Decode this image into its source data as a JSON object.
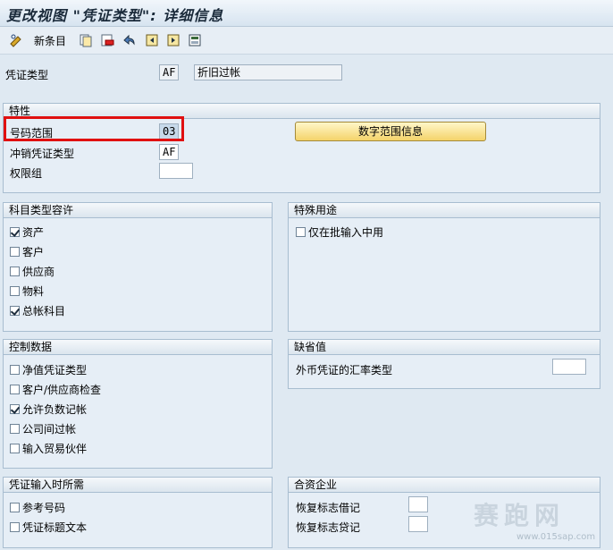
{
  "window": {
    "title": "更改视图 \"凭证类型\": 详细信息"
  },
  "toolbar": {
    "new_entries_label": "新条目"
  },
  "header": {
    "doc_type_label": "凭证类型",
    "doc_type_value": "AF",
    "doc_type_desc": "折旧过帐"
  },
  "properties": {
    "title": "特性",
    "number_range_label": "号码范围",
    "number_range_value": "03",
    "reverse_type_label": "冲销凭证类型",
    "reverse_type_value": "AF",
    "auth_group_label": "权限组",
    "auth_group_value": "",
    "number_range_button": "数字范围信息"
  },
  "account_types": {
    "title": "科目类型容许",
    "items": [
      {
        "label": "资产",
        "checked": true
      },
      {
        "label": "客户",
        "checked": false
      },
      {
        "label": "供应商",
        "checked": false
      },
      {
        "label": "物料",
        "checked": false
      },
      {
        "label": "总帐科目",
        "checked": true
      }
    ]
  },
  "special_usage": {
    "title": "特殊用途",
    "items": [
      {
        "label": "仅在批输入中用",
        "checked": false
      }
    ]
  },
  "control_data": {
    "title": "控制数据",
    "items": [
      {
        "label": "净值凭证类型",
        "checked": false
      },
      {
        "label": "客户/供应商检查",
        "checked": false
      },
      {
        "label": "允许负数记帐",
        "checked": true
      },
      {
        "label": "公司间过帐",
        "checked": false
      },
      {
        "label": "输入贸易伙伴",
        "checked": false
      }
    ]
  },
  "defaults": {
    "title": "缺省值",
    "rate_type_label": "外币凭证的汇率类型",
    "rate_type_value": ""
  },
  "required_entry": {
    "title": "凭证输入时所需",
    "items": [
      {
        "label": "参考号码",
        "checked": false
      },
      {
        "label": "凭证标题文本",
        "checked": false
      }
    ]
  },
  "joint_venture": {
    "title": "合资企业",
    "debit_label": "恢复标志借记",
    "debit_value": "",
    "credit_label": "恢复标志贷记",
    "credit_value": ""
  },
  "watermark": {
    "brand": "赛跑网",
    "url": "www.015sap.com"
  }
}
